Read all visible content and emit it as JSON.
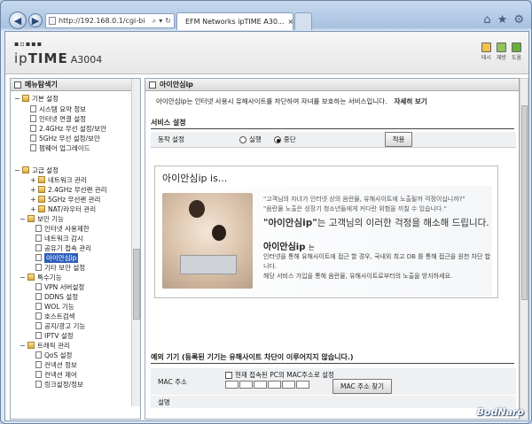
{
  "browser": {
    "url": "http://192.168.0.1/cgi-bi",
    "tab_title": "EFM Networks ipTIME A30...",
    "icons": [
      "back-icon",
      "forward-icon",
      "home-icon",
      "star-icon",
      "gear-icon"
    ]
  },
  "header": {
    "logo_prefix": "ip",
    "logo_bold": "TIME",
    "model": "A3004",
    "buttons": [
      {
        "label": "테시"
      },
      {
        "label": "재방"
      },
      {
        "label": "도움"
      }
    ]
  },
  "left": {
    "title": "메뉴탐색기",
    "groups": [
      {
        "label": "기본 설정",
        "items": [
          "시스템 요약 정보",
          "인터넷 연결 설정",
          "2.4GHz 무선 설정/보안",
          "5GHz 무선 설정/보안",
          "펌웨어 업그레이드"
        ]
      },
      {
        "label": "고급 설정",
        "items": [
          "네트워크 관리",
          "2.4GHz 무선랜 관리",
          "5GHz 무선랜 관리",
          "NAT/라우터 관리"
        ]
      },
      {
        "label": "보안 기능",
        "items": [
          "인터넷 사용제한",
          "네트워크 감시",
          "공유기 접속 관리",
          "아이안심ip",
          "기타 보안 설정"
        ]
      },
      {
        "label": "특수기능",
        "items": [
          "VPN 서버설정",
          "DDNS 설정",
          "WOL 기능",
          "호스트검색",
          "공지/광고 기능",
          "IPTV 설정"
        ]
      },
      {
        "label": "트래픽 관리",
        "items": [
          "QoS 설정",
          "컨넥션 정보",
          "컨넥션 제어",
          "링크설정/정보"
        ]
      }
    ],
    "selected": "아이안심ip"
  },
  "main": {
    "title": "아이안심ip",
    "intro": "아이안심ip는 인터넷 사용시 유해사이트를 차단하여 자녀를 보호하는 서비스입니다.",
    "detail_link": "자세히 보기",
    "service_section": "서비스 설정",
    "op_label": "동작 설정",
    "radio_run": "실행",
    "radio_stop": "중단",
    "apply": "적용",
    "promo_title": "아이안심ip is...",
    "quote1": "\"고객님의 자녀가 인터넷 상의 음란물, 유해사이트에 노출될까 걱정이십니까?\"",
    "quote2": "\"음란물 노출은 성장기 청소년들에게 커다란 위험을 끼칠 수 있습니다.\"",
    "big_bold": "\"아이안심ip\"",
    "big_rest": "는 고객님의 이러한 걱정을 해소해 드립니다.",
    "brand": "아이안심ip",
    "brand_suffix": "는",
    "desc1": "인터넷을 통해 유해사이트에 접근 할 경우, 국내외 최고 DB 를 통해 접근을 원천 차단 합니다.",
    "desc2": "해당 서비스 가입을 통해 음란물, 유해사이트로부터의 노출을 방지하세요.",
    "except_section": "예외 기기 (등록된 기기는 유해사이트 차단이 이루어지지 않습니다.)",
    "mac_label": "MAC 주소",
    "mac_checkbox": "현재 접속된 PC의 MAC주소로 설정",
    "mac_find": "MAC 주소 찾기",
    "desc_label": "설명"
  },
  "watermark": "BodNaro"
}
